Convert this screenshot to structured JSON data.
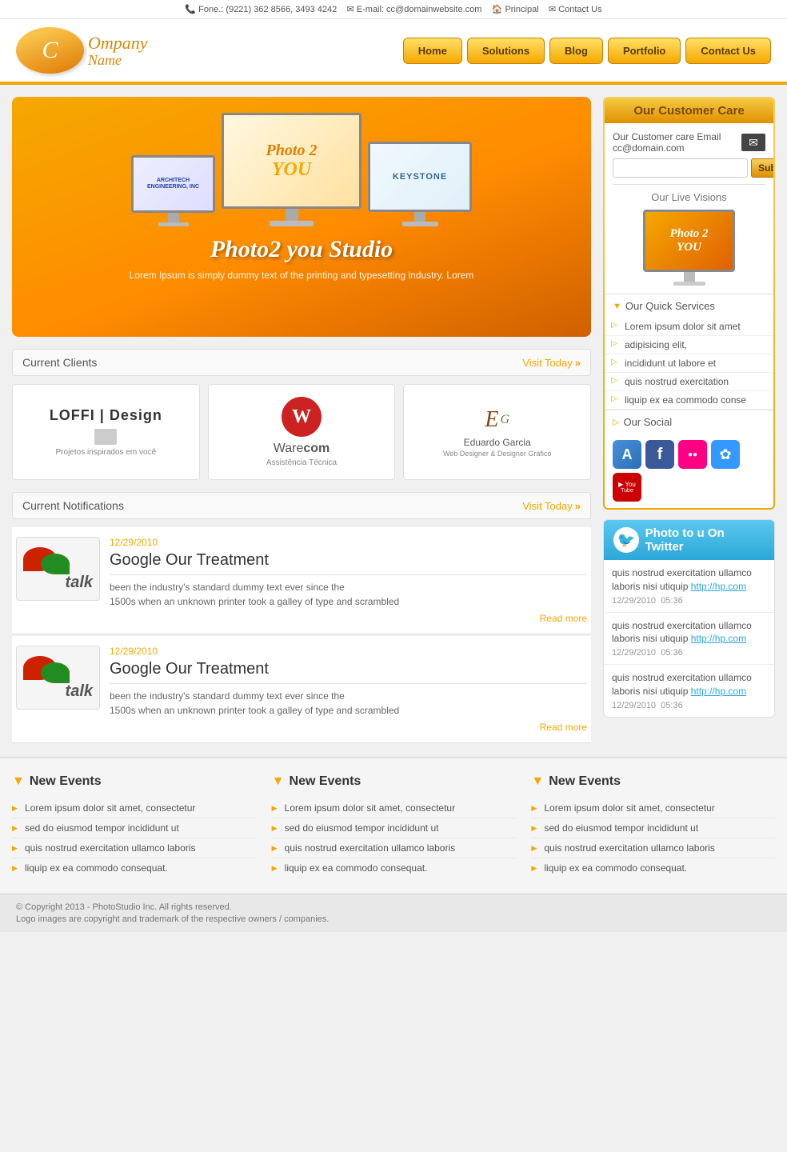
{
  "topbar": {
    "phone_icon": "📞",
    "phone": "Fone.: (9221) 362 8566, 3493 4242",
    "email_icon": "✉",
    "email": "E-mail: cc@domainwebsite.com",
    "principal_icon": "🏠",
    "principal": "Principal",
    "contact_icon": "✉",
    "contact": "Contact Us"
  },
  "logo": {
    "line1": "Ompany",
    "line2": "Name"
  },
  "nav": {
    "items": [
      "Home",
      "Solutions",
      "Blog",
      "Portfolio",
      "Contact Us"
    ]
  },
  "hero": {
    "title": "Photo2 you Studio",
    "subtitle": "Lorem Ipsum is simply dummy text of the printing and typesetting industry. Lorem",
    "monitors": [
      {
        "label": "ARCHITECH ENGINEERING, INC",
        "size": "s"
      },
      {
        "label": "Photo 2 YOU",
        "size": "lg"
      },
      {
        "label": "KEYSTONE",
        "size": "m"
      }
    ]
  },
  "clients": {
    "section_title": "Current Clients",
    "visit_label": "Visit Today",
    "items": [
      {
        "name": "LOFFI | Design",
        "sub": "Projetos inspirados em você"
      },
      {
        "name": "Warecom",
        "sub": "Assistência Técnica"
      },
      {
        "name": "Eduardo Garcia",
        "sub": "Web Designer & Designer Gráfico"
      }
    ]
  },
  "notifications": {
    "section_title": "Current Notifications",
    "visit_label": "Visit Today",
    "items": [
      {
        "date": "12/29/2010",
        "title": "Google Our Treatment",
        "text": "been the industry's standard dummy text ever since the\n1500s when an unknown printer took a galley of type and scrambled",
        "read_more": "Read more"
      },
      {
        "date": "12/29/2010",
        "title": "Google Our Treatment",
        "text": "been the industry's standard dummy text ever since the\n1500s when an unknown printer took a galley of type and scrambled",
        "read_more": "Read more"
      }
    ]
  },
  "sidebar": {
    "customer_care": {
      "title": "Our Customer Care",
      "care_label": "Our Customer care Email",
      "email": "cc@domain.com",
      "subscribe_placeholder": "",
      "subscribe_btn": "Subscribe"
    },
    "live_visions": {
      "title": "Our Live Visions",
      "screen_text": "Photo 2 YOU"
    },
    "quick_services": {
      "title": "Our Quick Services",
      "items": [
        "Lorem ipsum dolor sit amet",
        "adipisicing elit,",
        "incididunt ut labore et",
        "quis nostrud exercitation",
        "liquip ex ea commodo conse"
      ]
    },
    "social": {
      "title": "Our Social",
      "icons": [
        {
          "name": "app-icon",
          "class": "app",
          "symbol": "A"
        },
        {
          "name": "facebook-icon",
          "class": "fb",
          "symbol": "f"
        },
        {
          "name": "flickr-icon",
          "class": "flickr",
          "symbol": "●●"
        },
        {
          "name": "delicious-icon",
          "class": "delicious",
          "symbol": "✿"
        },
        {
          "name": "youtube-icon",
          "class": "yt",
          "symbol": "▶ You\nTube"
        }
      ]
    }
  },
  "twitter": {
    "title": "Photo to u On Twitter",
    "tweets": [
      {
        "text": "quis nostrud exercitation ullamco laboris nisi utiquip",
        "link": "http://hp.com",
        "date": "12/29/2010",
        "time": "05:36"
      },
      {
        "text": "quis nostrud exercitation ullamco laboris nisi utiquip",
        "link": "http://hp.com",
        "date": "12/29/2010",
        "time": "05:36"
      },
      {
        "text": "quis nostrud exercitation ullamco laboris nisi utiquip",
        "link": "http://hp.com",
        "date": "12/29/2010",
        "time": "05:36"
      }
    ]
  },
  "footer_cols": [
    {
      "title": "New Events",
      "items": [
        "Lorem ipsum dolor sit amet, consectetur",
        "sed do eiusmod tempor incididunt ut",
        "quis nostrud exercitation ullamco laboris",
        "liquip ex ea commodo consequat."
      ]
    },
    {
      "title": "New Events",
      "items": [
        "Lorem ipsum dolor sit amet, consectetur",
        "sed do eiusmod tempor incididunt ut",
        "quis nostrud exercitation ullamco laboris",
        "liquip ex ea commodo consequat."
      ]
    },
    {
      "title": "New Events",
      "items": [
        "Lorem ipsum dolor sit amet, consectetur",
        "sed do eiusmod tempor incididunt ut",
        "quis nostrud exercitation ullamco laboris",
        "liquip ex ea commodo consequat."
      ]
    }
  ],
  "bottom_footer": {
    "line1": "© Copyright 2013 - PhotoStudio Inc. All rights reserved.",
    "line2": "Logo images are copyright and trademark of the respective owners / companies."
  }
}
